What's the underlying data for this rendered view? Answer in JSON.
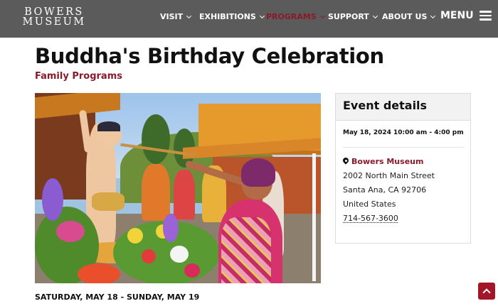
{
  "header": {
    "logo_line1": "BOWERS",
    "logo_line2": "MUSEUM",
    "nav": [
      {
        "label": "VISIT"
      },
      {
        "label": "EXHIBITIONS"
      },
      {
        "label": "PROGRAMS"
      },
      {
        "label": "SUPPORT"
      },
      {
        "label": "ABOUT US"
      }
    ],
    "menu_label": "MENU"
  },
  "event": {
    "title": "Buddha's Birthday Celebration",
    "category": "Family Programs",
    "date_range": "SATURDAY, MAY 18 - SUNDAY, MAY 19"
  },
  "details": {
    "heading": "Event details",
    "datetime": "May 18, 2024 10:00 am - 4:00 pm",
    "venue": "Bowers Museum",
    "street": "2002 North Main Street",
    "city": "Santa Ana, CA 92706",
    "country": "United States",
    "phone": "714-567-3600"
  },
  "colors": {
    "header_bg": "#5b5b5b",
    "accent": "#8b1a2b",
    "back_to_top": "#a3162a"
  }
}
